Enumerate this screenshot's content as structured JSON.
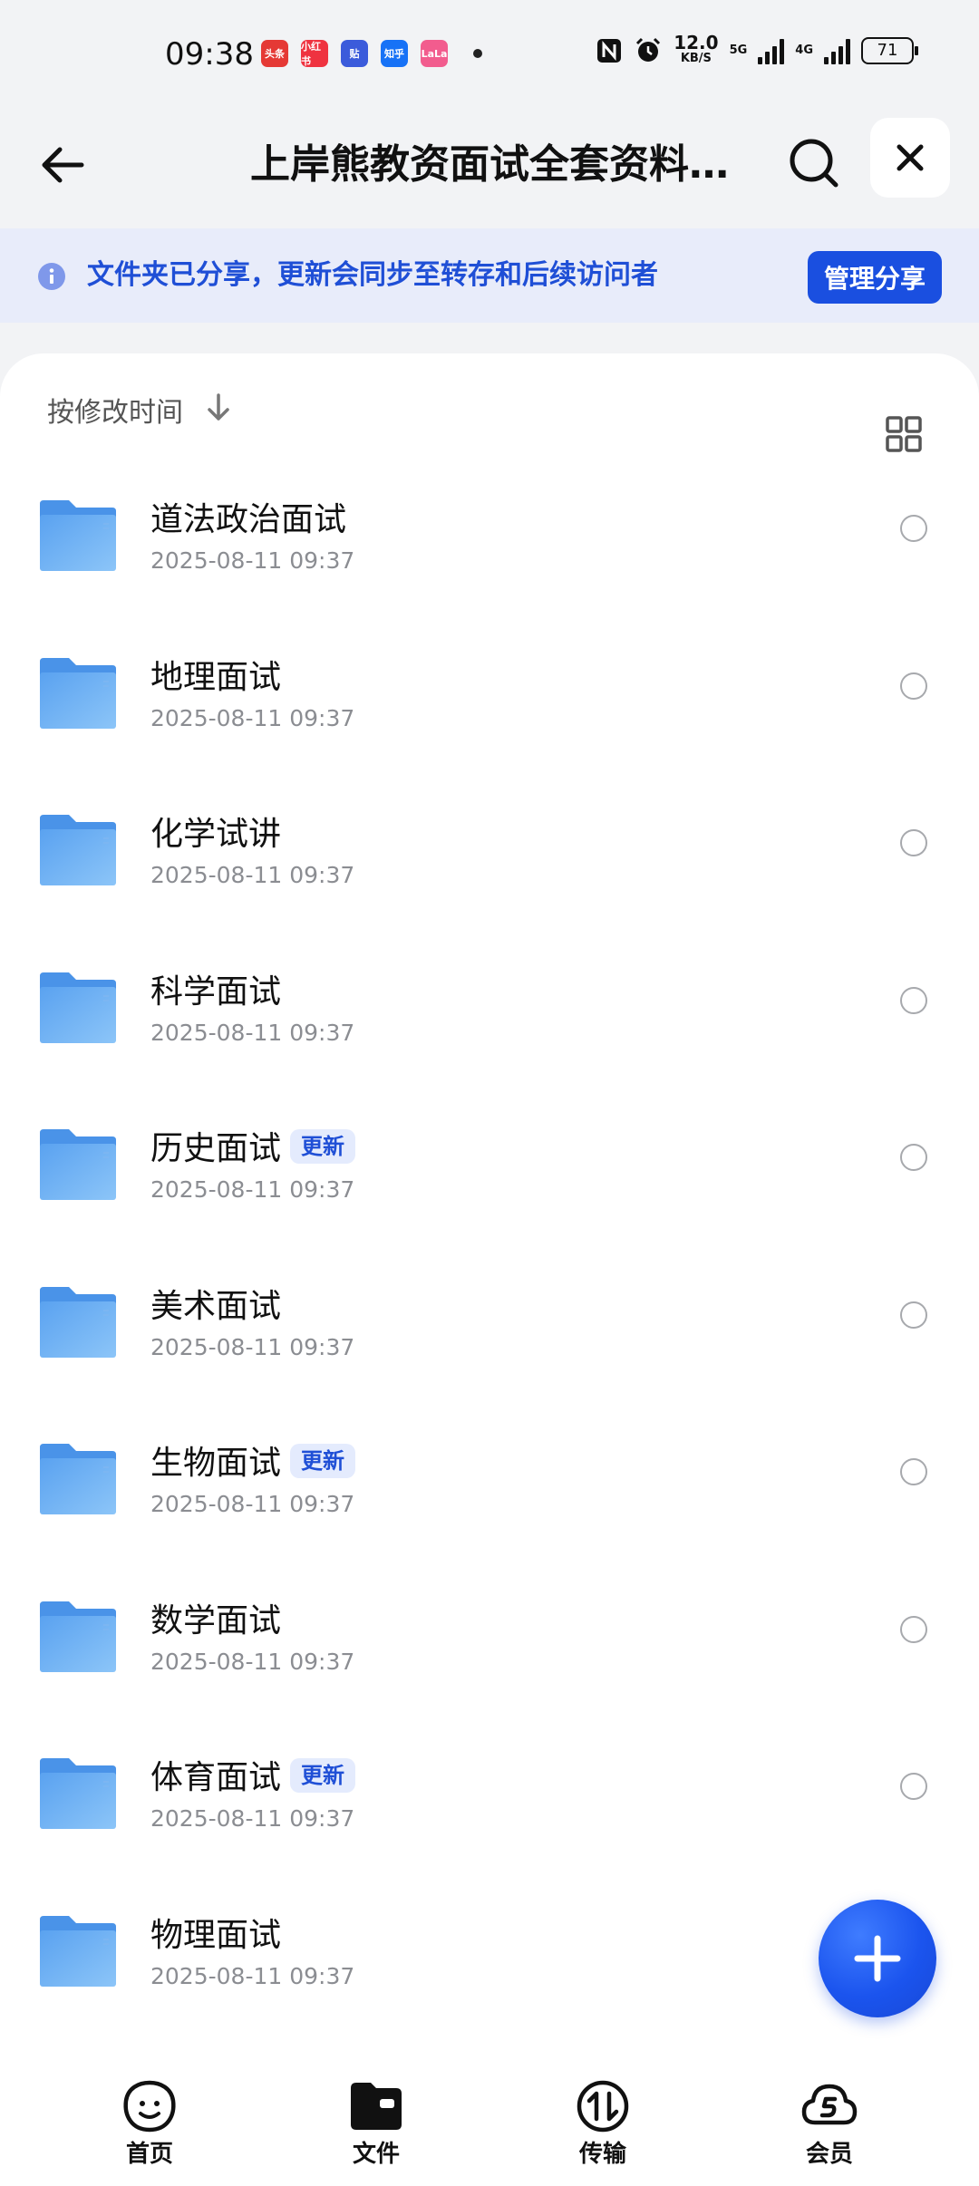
{
  "status_bar": {
    "time": "09:38",
    "notifications": [
      {
        "icon": "toutiao-icon",
        "text": "头条",
        "color": "#e53935"
      },
      {
        "icon": "xiaohongshu-icon",
        "text": "小红书",
        "color": "#ef3340"
      },
      {
        "icon": "tieba-icon",
        "text": "贴",
        "color": "#3b5bdb"
      },
      {
        "icon": "zhihu-icon",
        "text": "知乎",
        "color": "#1772f6"
      },
      {
        "icon": "lalal-icon",
        "text": "LaLa",
        "color": "#f25c8e"
      }
    ],
    "net_speed": "12.0",
    "net_unit": "KB/S",
    "net_5g": "5G",
    "net_4g": "4G",
    "battery": "71"
  },
  "header": {
    "title": "上岸熊教资面试全套资料全国..."
  },
  "banner": {
    "text": "文件夹已分享，更新会同步至转存和后续访问者",
    "manage_label": "管理分享",
    "accent": "#1a4fe0"
  },
  "sort": {
    "label": "按修改时间"
  },
  "files": [
    {
      "name": "道法政治面试",
      "date": "2025-08-11 09:37",
      "badge": ""
    },
    {
      "name": "地理面试",
      "date": "2025-08-11 09:37",
      "badge": ""
    },
    {
      "name": "化学试讲",
      "date": "2025-08-11 09:37",
      "badge": ""
    },
    {
      "name": "科学面试",
      "date": "2025-08-11 09:37",
      "badge": ""
    },
    {
      "name": "历史面试",
      "date": "2025-08-11 09:37",
      "badge": "更新"
    },
    {
      "name": "美术面试",
      "date": "2025-08-11 09:37",
      "badge": ""
    },
    {
      "name": "生物面试",
      "date": "2025-08-11 09:37",
      "badge": "更新"
    },
    {
      "name": "数学面试",
      "date": "2025-08-11 09:37",
      "badge": ""
    },
    {
      "name": "体育面试",
      "date": "2025-08-11 09:37",
      "badge": "更新"
    },
    {
      "name": "物理面试",
      "date": "2025-08-11 09:37",
      "badge": ""
    }
  ],
  "tabs": [
    {
      "label": "首页",
      "icon": "home-face-icon"
    },
    {
      "label": "文件",
      "icon": "folder-icon"
    },
    {
      "label": "传输",
      "icon": "transfer-icon"
    },
    {
      "label": "会员",
      "icon": "vip-cloud-icon"
    }
  ]
}
